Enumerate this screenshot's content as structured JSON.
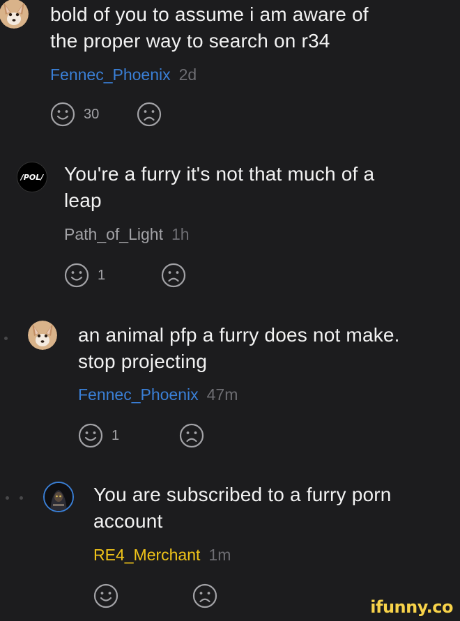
{
  "comments": [
    {
      "avatar": "fennec-fox-avatar",
      "lines": [
        "bold of you to assume i am aware of",
        "the proper way to search on r34"
      ],
      "username": "Fennec_Phoenix",
      "time": "2d",
      "up_count": "30",
      "down_count": ""
    },
    {
      "avatar": "pol-avatar",
      "avatar_text": "/POL/",
      "lines": [
        "You're a furry it's not that much of a",
        "leap"
      ],
      "username": "Path_of_Light",
      "time": "1h",
      "up_count": "1",
      "down_count": ""
    },
    {
      "avatar": "fennec-fox-avatar",
      "lines": [
        "an animal pfp a furry does not make.",
        "stop projecting"
      ],
      "username": "Fennec_Phoenix",
      "time": "47m",
      "up_count": "1",
      "down_count": ""
    },
    {
      "avatar": "character-avatar",
      "lines": [
        "You are subscribed to a furry porn",
        "account"
      ],
      "username": "RE4_Merchant",
      "time": "1m",
      "up_count": "",
      "down_count": ""
    }
  ],
  "icons": {
    "upvote": "smiley-face-icon",
    "downvote": "sad-face-icon"
  },
  "colors": {
    "background": "#1c1c1e",
    "username_blue": "#3a7fd6",
    "username_gold": "#f0c419",
    "username_gray": "#a2a2a6",
    "timestamp": "#6e6e73",
    "watermark": "#f8d34a"
  },
  "watermark": "ifunny.co"
}
